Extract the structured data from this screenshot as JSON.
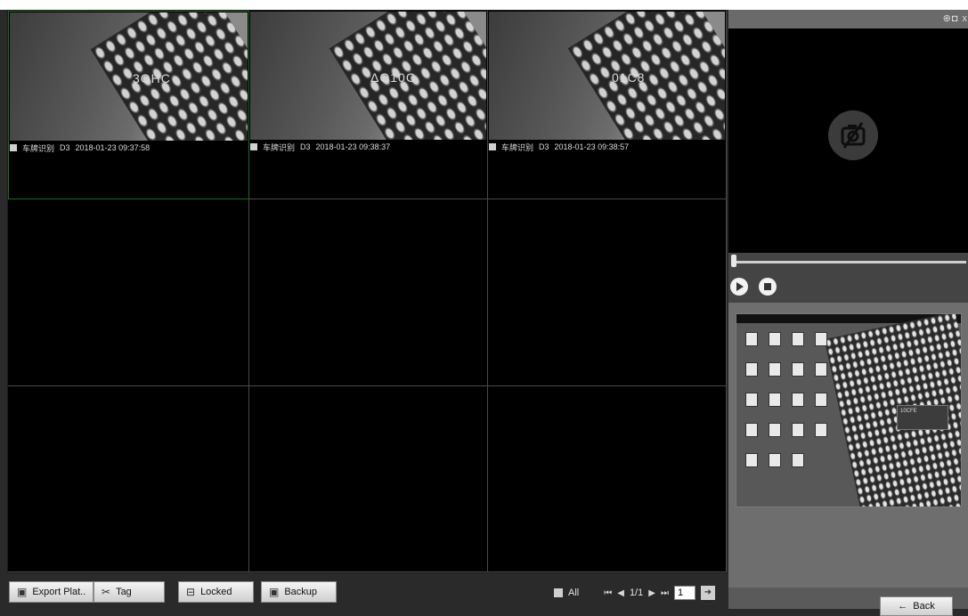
{
  "grid": {
    "cells": [
      {
        "plate": "3OHC",
        "caption_label": "车牌识别",
        "channel": "D3",
        "timestamp": "2018-01-23 09:37:58"
      },
      {
        "plate": "ΔO10C",
        "caption_label": "车牌识别",
        "channel": "D3",
        "timestamp": "2018-01-23 09:38:37"
      },
      {
        "plate": "01C8",
        "caption_label": "车牌识别",
        "channel": "D3",
        "timestamp": "2018-01-23 09:38:57"
      }
    ]
  },
  "right_panel": {
    "toolbar_icons": [
      "zoom-icon",
      "snapshot-icon",
      "close-icon"
    ],
    "toolbar_text": "⊕◘ x",
    "empty_viewer_icon": "no-camera-icon",
    "seek_position": 0.0,
    "snapshot_note": "10CFE"
  },
  "toolbar": {
    "export_label": "Export Plat..",
    "tag_label": "Tag",
    "locked_label": "Locked",
    "backup_label": "Backup"
  },
  "pager": {
    "all_label": "All",
    "page_text": "1/1",
    "page_input": "1"
  },
  "back_label": "Back",
  "colors": {
    "selected_border": "#1d6b1d",
    "background": "#2a2a2a"
  }
}
